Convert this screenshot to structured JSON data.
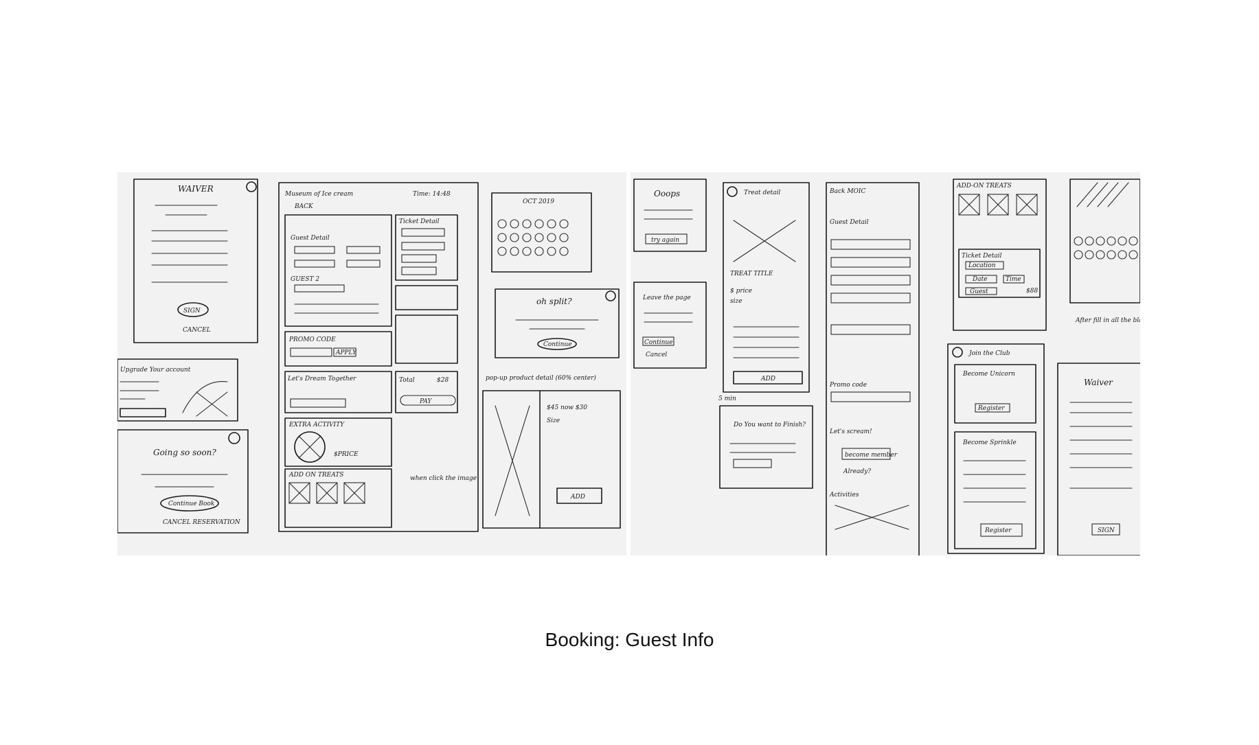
{
  "caption": "Booking: Guest Info",
  "sketches": {
    "left": {
      "waiver_title": "WAIVER",
      "waiver_sign": "SIGN",
      "waiver_cancel": "CANCEL",
      "header_title": "Museum of Ice cream",
      "header_time": "Time: 14:48",
      "back": "BACK",
      "guest_detail": "Guest Detail",
      "guest_2": "GUEST 2",
      "ticket_detail": "Ticket Detail",
      "promo_code": "PROMO CODE",
      "apply": "APPLY",
      "lets_dream": "Let's Dream Together",
      "extra_activity": "EXTRA ACTIVITY",
      "add_on_treats": "ADD ON TREATS",
      "price": "$PRICE",
      "add": "ADD",
      "total": "Total",
      "total_value": "$28",
      "pay": "PAY",
      "calendar_month": "OCT 2019",
      "split_title": "oh split?",
      "continue": "Continue",
      "upgrade": "Upgrade Your account",
      "going_soon": "Going so soon?",
      "continue_book": "Continue Book",
      "cancel_reservation": "CANCEL RESERVATION",
      "popup_note": "pop-up product detail (60% center)",
      "click_note": "when click the image",
      "size": "Size",
      "price_now": "$45 now $30"
    },
    "right": {
      "ooops": "Ooops",
      "try_again": "try again",
      "leave_page": "Leave the page",
      "continue": "Continue",
      "cancel": "Cancel",
      "treat_detail": "Treat detail",
      "treat_title": "TREAT TITLE",
      "treat_price": "$ price",
      "treat_size": "size",
      "add": "ADD",
      "finish_q": "Do You want to Finish?",
      "finish_time": "5 min",
      "back_moic": "Back MOIC",
      "guest_detail": "Guest Detail",
      "promo_code": "Promo code",
      "lets_scream": "Let's scream!",
      "become_member": "become member",
      "already": "Already?",
      "activities": "Activities",
      "add_on_treats": "ADD-ON TREATS",
      "ticket_detail": "Ticket Detail",
      "location": "Location",
      "date": "Date",
      "time": "Time",
      "guest": "Guest",
      "ticket_price": "$88",
      "join_club": "Join the Club",
      "become_unicorn": "Become Unicorn",
      "register": "Register",
      "become_sprinkle": "Become Sprinkle",
      "waiver": "Waiver",
      "sign": "SIGN",
      "after_fill": "After fill in all the blanks, change state."
    }
  }
}
